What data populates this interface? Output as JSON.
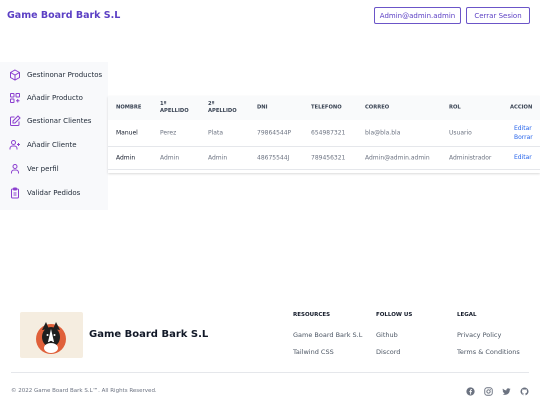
{
  "header": {
    "brand": "Game Board Bark S.L",
    "user_button": "Admin@admin.admin",
    "logout_button": "Cerrar Sesion"
  },
  "sidebar": {
    "items": [
      {
        "label": "Gestinonar Productos",
        "icon": "cube-icon"
      },
      {
        "label": "Añadir Producto",
        "icon": "add-product-icon"
      },
      {
        "label": "Gestionar Clientes",
        "icon": "edit-icon"
      },
      {
        "label": "Añadir Cliente",
        "icon": "user-plus-icon"
      },
      {
        "label": "Ver perfil",
        "icon": "user-icon"
      },
      {
        "label": "Validar Pedidos",
        "icon": "clipboard-icon"
      }
    ]
  },
  "table": {
    "headers": [
      "NOMBRE",
      "1º APELLIDO",
      "2º APELLIDO",
      "DNI",
      "TELEFONO",
      "CORREO",
      "ROL",
      "ACCION"
    ],
    "rows": [
      {
        "nombre": "Manuel",
        "apellido1": "Perez",
        "apellido2": "Plata",
        "dni": "79864544P",
        "telefono": "654987321",
        "correo": "bla@bla.bla",
        "rol": "Usuario",
        "acciones": [
          "Editar",
          "Borrar"
        ]
      },
      {
        "nombre": "Admin",
        "apellido1": "Admin",
        "apellido2": "Admin",
        "dni": "48675544J",
        "telefono": "789456321",
        "correo": "Admin@admin.admin",
        "rol": "Administrador",
        "acciones": [
          "Editar"
        ]
      }
    ]
  },
  "footer": {
    "company": "Game Board Bark S.L",
    "resources": {
      "heading": "RESOURCES",
      "links": [
        "Game Board Bark S.L",
        "Tailwind CSS"
      ]
    },
    "follow": {
      "heading": "FOLLOW US",
      "links": [
        "Github",
        "Discord"
      ]
    },
    "legal": {
      "heading": "LEGAL",
      "links": [
        "Privacy Policy",
        "Terms & Conditions"
      ]
    },
    "copyright": "© 2022 Game Board Bark S.L™. All Rights Reserved.",
    "social_icons": [
      "facebook-icon",
      "instagram-icon",
      "twitter-icon",
      "github-icon"
    ]
  },
  "colors": {
    "accent": "#5b3fc4",
    "link": "#2563eb",
    "sidebar_bg": "#f8f9fb"
  }
}
